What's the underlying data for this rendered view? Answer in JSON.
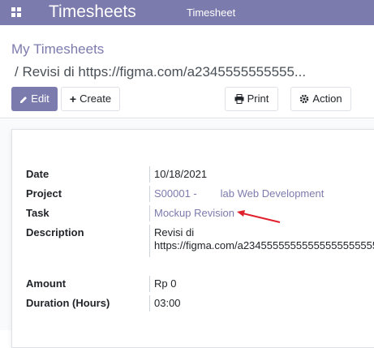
{
  "navbar": {
    "app_title": "Timesheets",
    "menu_item": "Timesheet"
  },
  "breadcrumb": {
    "root": "My Timesheets",
    "current": "/ Revisi di https://figma.com/a2345555555555..."
  },
  "toolbar": {
    "edit_label": "Edit",
    "create_label": "Create",
    "print_label": "Print",
    "action_label": "Action"
  },
  "form": {
    "date": {
      "label": "Date",
      "value": "10/18/2021"
    },
    "project": {
      "label": "Project",
      "value": "S00001 -        lab Web Development"
    },
    "task": {
      "label": "Task",
      "value": "Mockup Revision"
    },
    "description": {
      "label": "Description",
      "line1": "Revisi di",
      "line2": "https://figma.com/a2345555555555555555555555"
    },
    "amount": {
      "label": "Amount",
      "value": "Rp 0"
    },
    "duration": {
      "label": "Duration (Hours)",
      "value": "03:00"
    }
  },
  "colors": {
    "brand": "#7c7bad",
    "annotation_arrow": "#e0212d"
  }
}
